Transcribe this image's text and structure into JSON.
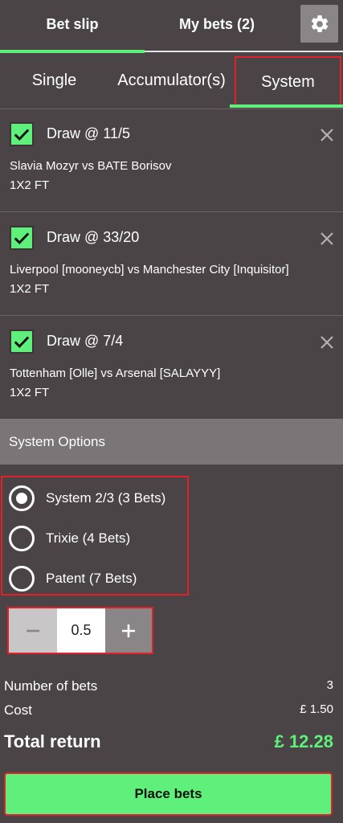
{
  "header": {
    "tabs": [
      {
        "label": "Bet slip",
        "active": true
      },
      {
        "label": "My bets (2)",
        "active": false
      }
    ],
    "settings_icon": "gear-icon"
  },
  "bet_types": [
    {
      "label": "Single",
      "active": false
    },
    {
      "label": "Accumulator(s)",
      "active": false
    },
    {
      "label": "System",
      "active": true
    }
  ],
  "selections": [
    {
      "checked": true,
      "title": "Draw @ 11/5",
      "match": "Slavia Mozyr  vs  BATE Borisov",
      "market": "1X2 FT"
    },
    {
      "checked": true,
      "title": "Draw @ 33/20",
      "match": "Liverpool [mooneycb]  vs  Manchester City [Inquisitor]",
      "market": "1X2 FT"
    },
    {
      "checked": true,
      "title": "Draw @ 7/4",
      "match": "Tottenham [Olle]  vs  Arsenal [SALAYYY]",
      "market": "1X2 FT"
    }
  ],
  "system_options": {
    "header": "System Options",
    "options": [
      {
        "label": "System 2/3 (3 Bets)",
        "selected": true
      },
      {
        "label": "Trixie (4 Bets)",
        "selected": false
      },
      {
        "label": "Patent (7 Bets)",
        "selected": false
      }
    ]
  },
  "stake": {
    "value": "0.5",
    "minus_label": "−",
    "plus_label": "+"
  },
  "summary": {
    "number_of_bets_label": "Number of bets",
    "number_of_bets_value": "3",
    "cost_label": "Cost",
    "cost_value": "£ 1.50",
    "total_return_label": "Total return",
    "total_return_value": "£ 12.28"
  },
  "place_bets_label": "Place bets",
  "colors": {
    "accent": "#5ef07a",
    "background": "#4a4446",
    "highlight_border": "#e0202a"
  }
}
